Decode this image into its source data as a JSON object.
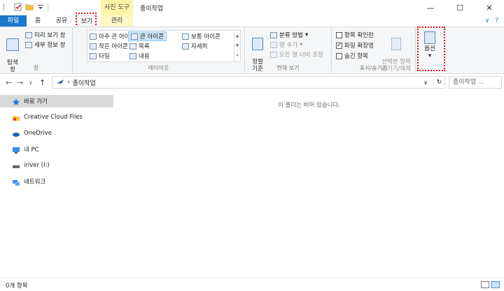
{
  "window": {
    "title": "종이작업",
    "context_group_label": "사진 도구",
    "minimize": "—",
    "maximize": "☐",
    "close": "✕"
  },
  "tabs": {
    "file": "파일",
    "home": "홈",
    "share": "공유",
    "view": "보기",
    "manage": "관리",
    "expand_icon": "∨",
    "help_icon": "?"
  },
  "ribbon": {
    "pane": {
      "nav_pane_label": "탐색\n창",
      "preview_pane": "미리 보기 창",
      "details_pane": "세부 정보 창",
      "group_label": "창"
    },
    "layout": {
      "items": [
        "아주 큰 아이콘",
        "큰 아이콘",
        "보통 아이콘",
        "작은 아이콘",
        "목록",
        "자세히",
        "타일",
        "내용"
      ],
      "selected": "큰 아이콘",
      "group_label": "레이아웃"
    },
    "current_view": {
      "sort_label": "정렬\n기준",
      "group_by": "분류 방법",
      "add_columns": "열 추가",
      "fit_columns": "모든 열 너비 조정",
      "group_label": "현재 보기"
    },
    "show_hide": {
      "item_checkboxes": "항목 확인란",
      "file_extensions": "파일 확장명",
      "hidden_items": "숨긴 항목",
      "item_checkboxes_checked": false,
      "file_extensions_checked": true,
      "hidden_items_checked": false,
      "hide_selected": "선택한 항목\n숨기기/해제",
      "group_label": "표시/숨기기"
    },
    "options": {
      "label": "옵션"
    }
  },
  "address": {
    "back": "←",
    "forward": "→",
    "recent": "∨",
    "up": "↑",
    "separator": "›",
    "path": "종이작업",
    "dropdown": "∨",
    "refresh": "↻",
    "search_placeholder": "종이작업 ..."
  },
  "sidebar": {
    "items": [
      {
        "label": "바로 가기",
        "icon": "star-icon"
      },
      {
        "label": "Creative Cloud Files",
        "icon": "folder-icon"
      },
      {
        "label": "OneDrive",
        "icon": "cloud-icon"
      },
      {
        "label": "내 PC",
        "icon": "pc-icon"
      },
      {
        "label": "iriver (I:)",
        "icon": "drive-icon"
      },
      {
        "label": "네트워크",
        "icon": "network-icon"
      }
    ]
  },
  "content": {
    "empty_message": "이 폴더는 비어 있습니다."
  },
  "status": {
    "item_count": "0개 항목"
  }
}
